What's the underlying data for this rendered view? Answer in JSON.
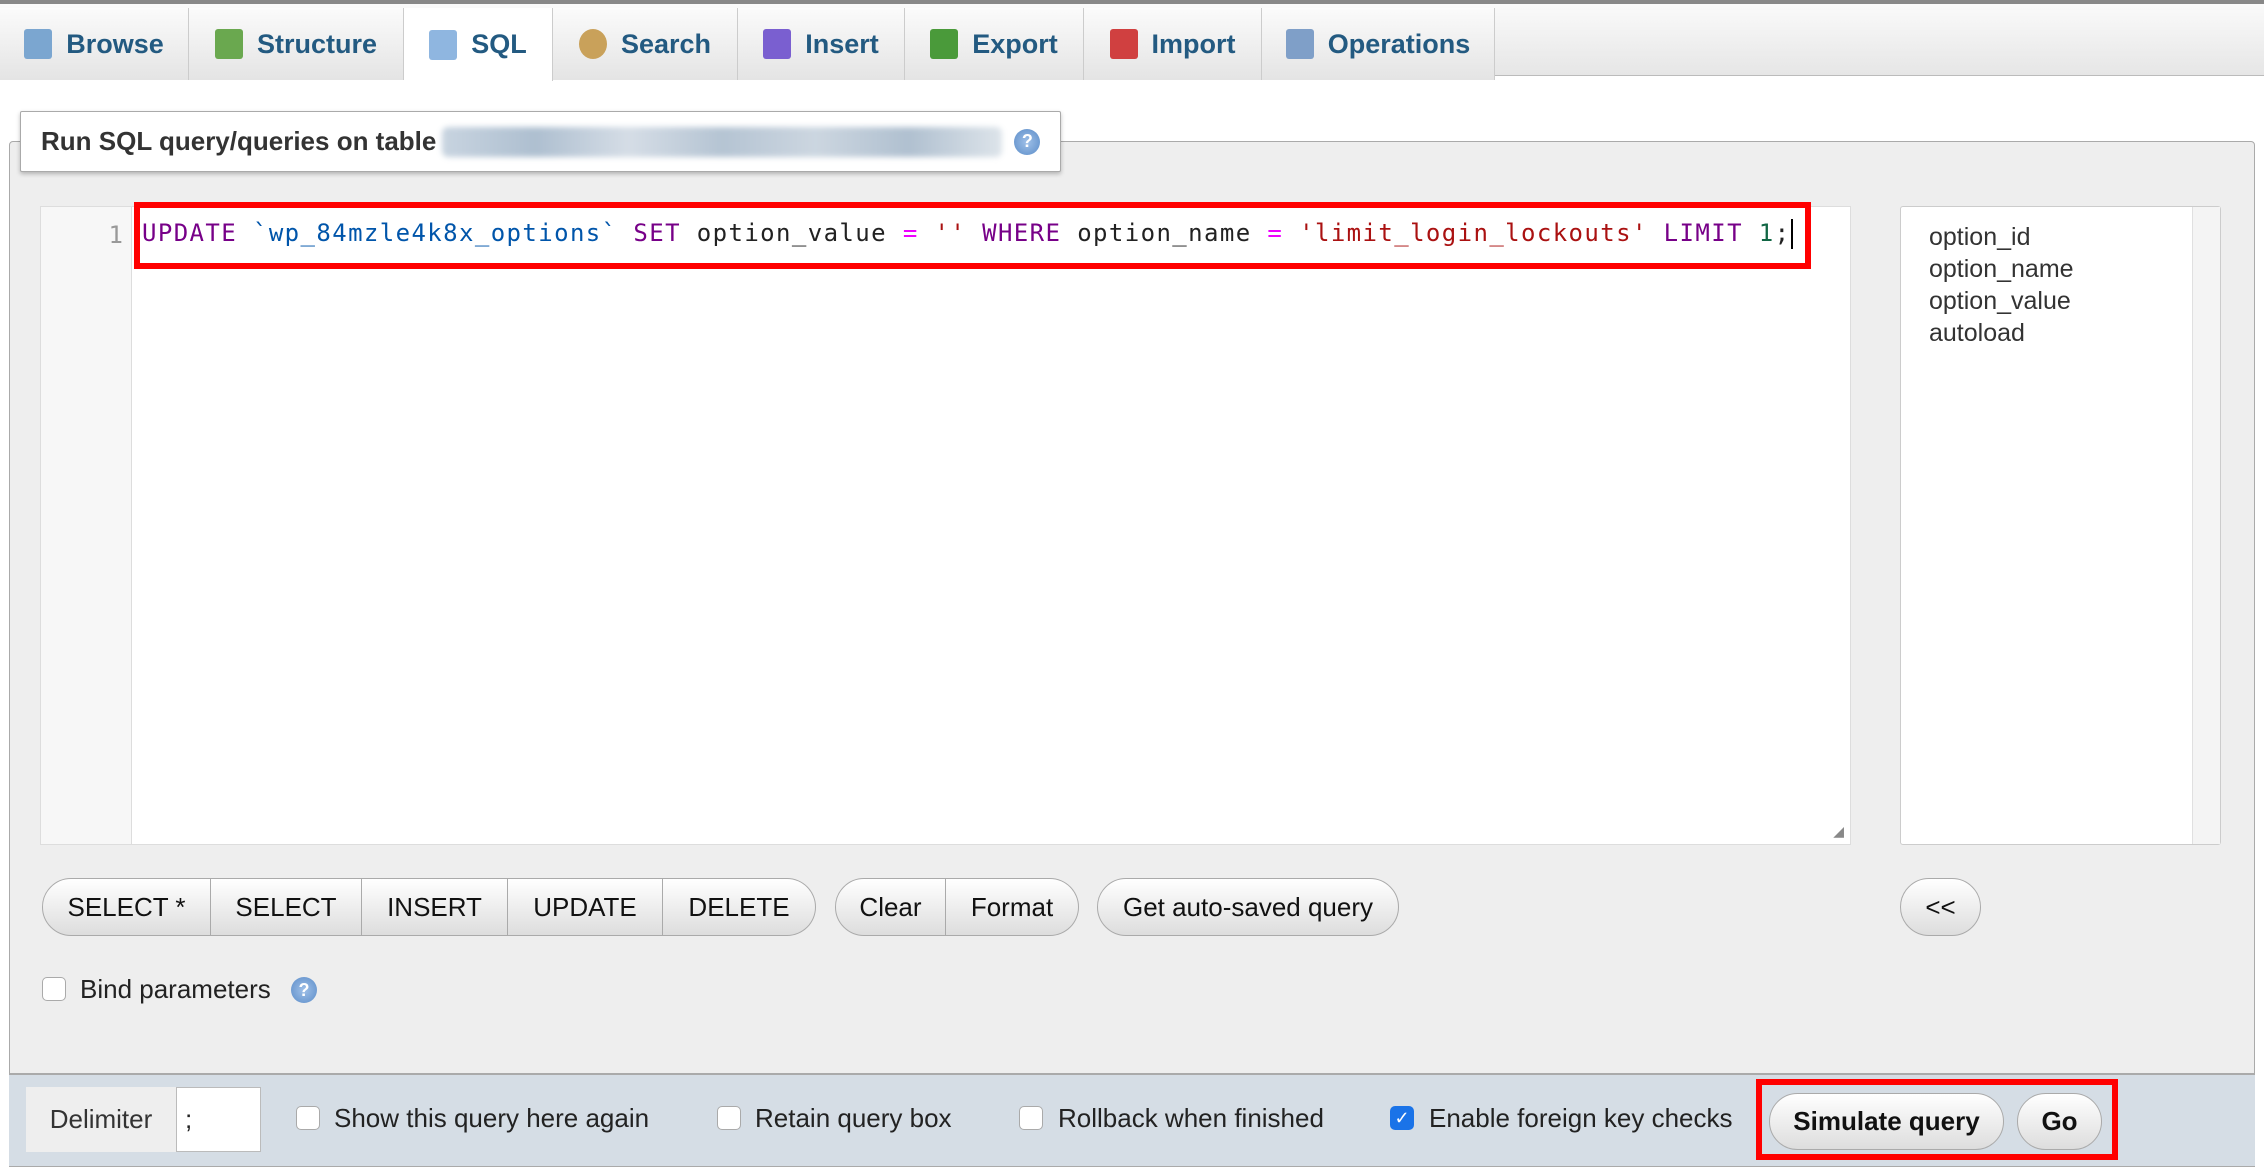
{
  "tabs": [
    {
      "label": "Browse",
      "icon": "browse-icon",
      "color": "#7ba6d0"
    },
    {
      "label": "Structure",
      "icon": "structure-icon",
      "color": "#6aa84f"
    },
    {
      "label": "SQL",
      "icon": "sql-icon",
      "color": "#8fb6e0"
    },
    {
      "label": "Search",
      "icon": "search-icon",
      "color": "#c9a15a"
    },
    {
      "label": "Insert",
      "icon": "insert-icon",
      "color": "#7a5fd0"
    },
    {
      "label": "Export",
      "icon": "export-icon",
      "color": "#4a9a3a"
    },
    {
      "label": "Import",
      "icon": "import-icon",
      "color": "#d04040"
    },
    {
      "label": "Operations",
      "icon": "wrench-icon",
      "color": "#7f9fc8"
    }
  ],
  "active_tab": "SQL",
  "legend": {
    "title": "Run SQL query/queries on table"
  },
  "editor": {
    "line_number": "1",
    "tokens": [
      "UPDATE",
      " ",
      "`wp_84mzle4k8x_options`",
      " ",
      "SET",
      " option_value ",
      "=",
      " ",
      "''",
      " ",
      "WHERE",
      " option_name ",
      "=",
      " ",
      "'limit_login_lockouts'",
      " ",
      "LIMIT",
      " ",
      "1",
      ";"
    ]
  },
  "columns": [
    "option_id",
    "option_name",
    "option_value",
    "autoload"
  ],
  "buttons": {
    "select_star": "SELECT *",
    "select": "SELECT",
    "insert": "INSERT",
    "update": "UPDATE",
    "delete": "DELETE",
    "clear": "Clear",
    "format": "Format",
    "get_autosaved": "Get auto-saved query",
    "insert_column": "<<"
  },
  "bind_parameters": {
    "label": "Bind parameters",
    "checked": false
  },
  "bottom": {
    "delimiter_label": "Delimiter",
    "delimiter_value": ";",
    "show_query_again": {
      "label": "Show this query here again",
      "checked": false
    },
    "retain_query_box": {
      "label": "Retain query box",
      "checked": false
    },
    "rollback": {
      "label": "Rollback when finished",
      "checked": false
    },
    "foreign_key_checks": {
      "label": "Enable foreign key checks",
      "checked": true
    },
    "simulate_label": "Simulate query",
    "go_label": "Go"
  },
  "highlight_color": "#ff0000"
}
